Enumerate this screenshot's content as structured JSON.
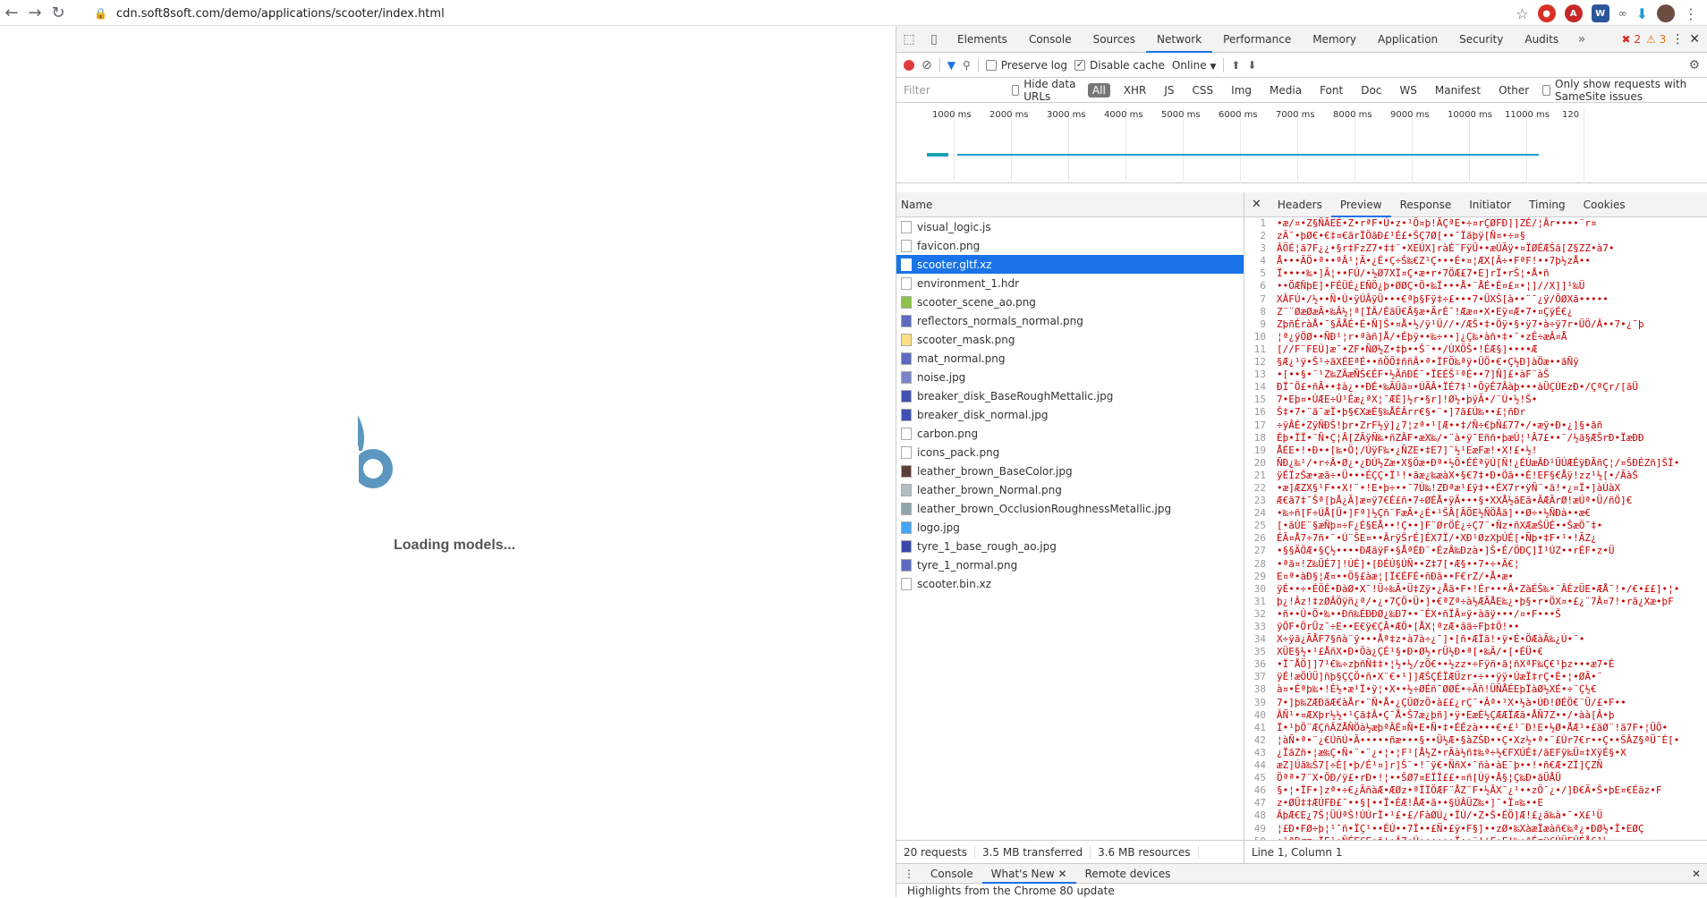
{
  "browser": {
    "url": "cdn.soft8soft.com/demo/applications/scooter/index.html"
  },
  "page": {
    "loading_text": "Loading models..."
  },
  "devtools": {
    "tabs": [
      "Elements",
      "Console",
      "Sources",
      "Network",
      "Performance",
      "Memory",
      "Application",
      "Security",
      "Audits"
    ],
    "active_tab": "Network",
    "errors": "2",
    "warnings": "3",
    "toolbar": {
      "preserve_log": "Preserve log",
      "disable_cache": "Disable cache",
      "throttle": "Online"
    },
    "filter": {
      "placeholder": "Filter",
      "hide_data_urls": "Hide data URLs",
      "types": [
        "All",
        "XHR",
        "JS",
        "CSS",
        "Img",
        "Media",
        "Font",
        "Doc",
        "WS",
        "Manifest",
        "Other"
      ],
      "samesite": "Only show requests with SameSite issues"
    },
    "timeline_ticks": [
      "1000 ms",
      "2000 ms",
      "3000 ms",
      "4000 ms",
      "5000 ms",
      "6000 ms",
      "7000 ms",
      "8000 ms",
      "9000 ms",
      "10000 ms",
      "11000 ms",
      "120"
    ],
    "name_header": "Name",
    "files": [
      "visual_logic.js",
      "favicon.png",
      "scooter.gltf.xz",
      "environment_1.hdr",
      "scooter_scene_ao.png",
      "reflectors_normals_normal.png",
      "scooter_mask.png",
      "mat_normal.png",
      "noise.jpg",
      "breaker_disk_BaseRoughMettalic.jpg",
      "breaker_disk_normal.jpg",
      "carbon.png",
      "icons_pack.png",
      "leather_brown_BaseColor.jpg",
      "leather_brown_Normal.png",
      "leather_brown_OcclusionRoughnessMetallic.jpg",
      "logo.jpg",
      "tyre_1_base_rough_ao.jpg",
      "tyre_1_normal.png",
      "scooter.bin.xz"
    ],
    "selected_file": "scooter.gltf.xz",
    "status": {
      "requests": "20 requests",
      "transferred": "3.5 MB transferred",
      "resources": "3.6 MB resources"
    },
    "preview_tabs": [
      "Headers",
      "Preview",
      "Response",
      "Initiator",
      "Timing",
      "Cookies"
    ],
    "active_preview_tab": "Preview",
    "cursor_pos": "Line 1, Column 1",
    "drawer_tabs": [
      "Console",
      "What's New",
      "Remote devices"
    ],
    "active_drawer_tab": "What's New",
    "drawer_message": "Highlights from the Chrome 80 update"
  },
  "colors": {
    "accent": "#1a73e8",
    "record": "#e13c3c",
    "code_text": "#c80000",
    "logo_blue": "#5b97c0"
  }
}
